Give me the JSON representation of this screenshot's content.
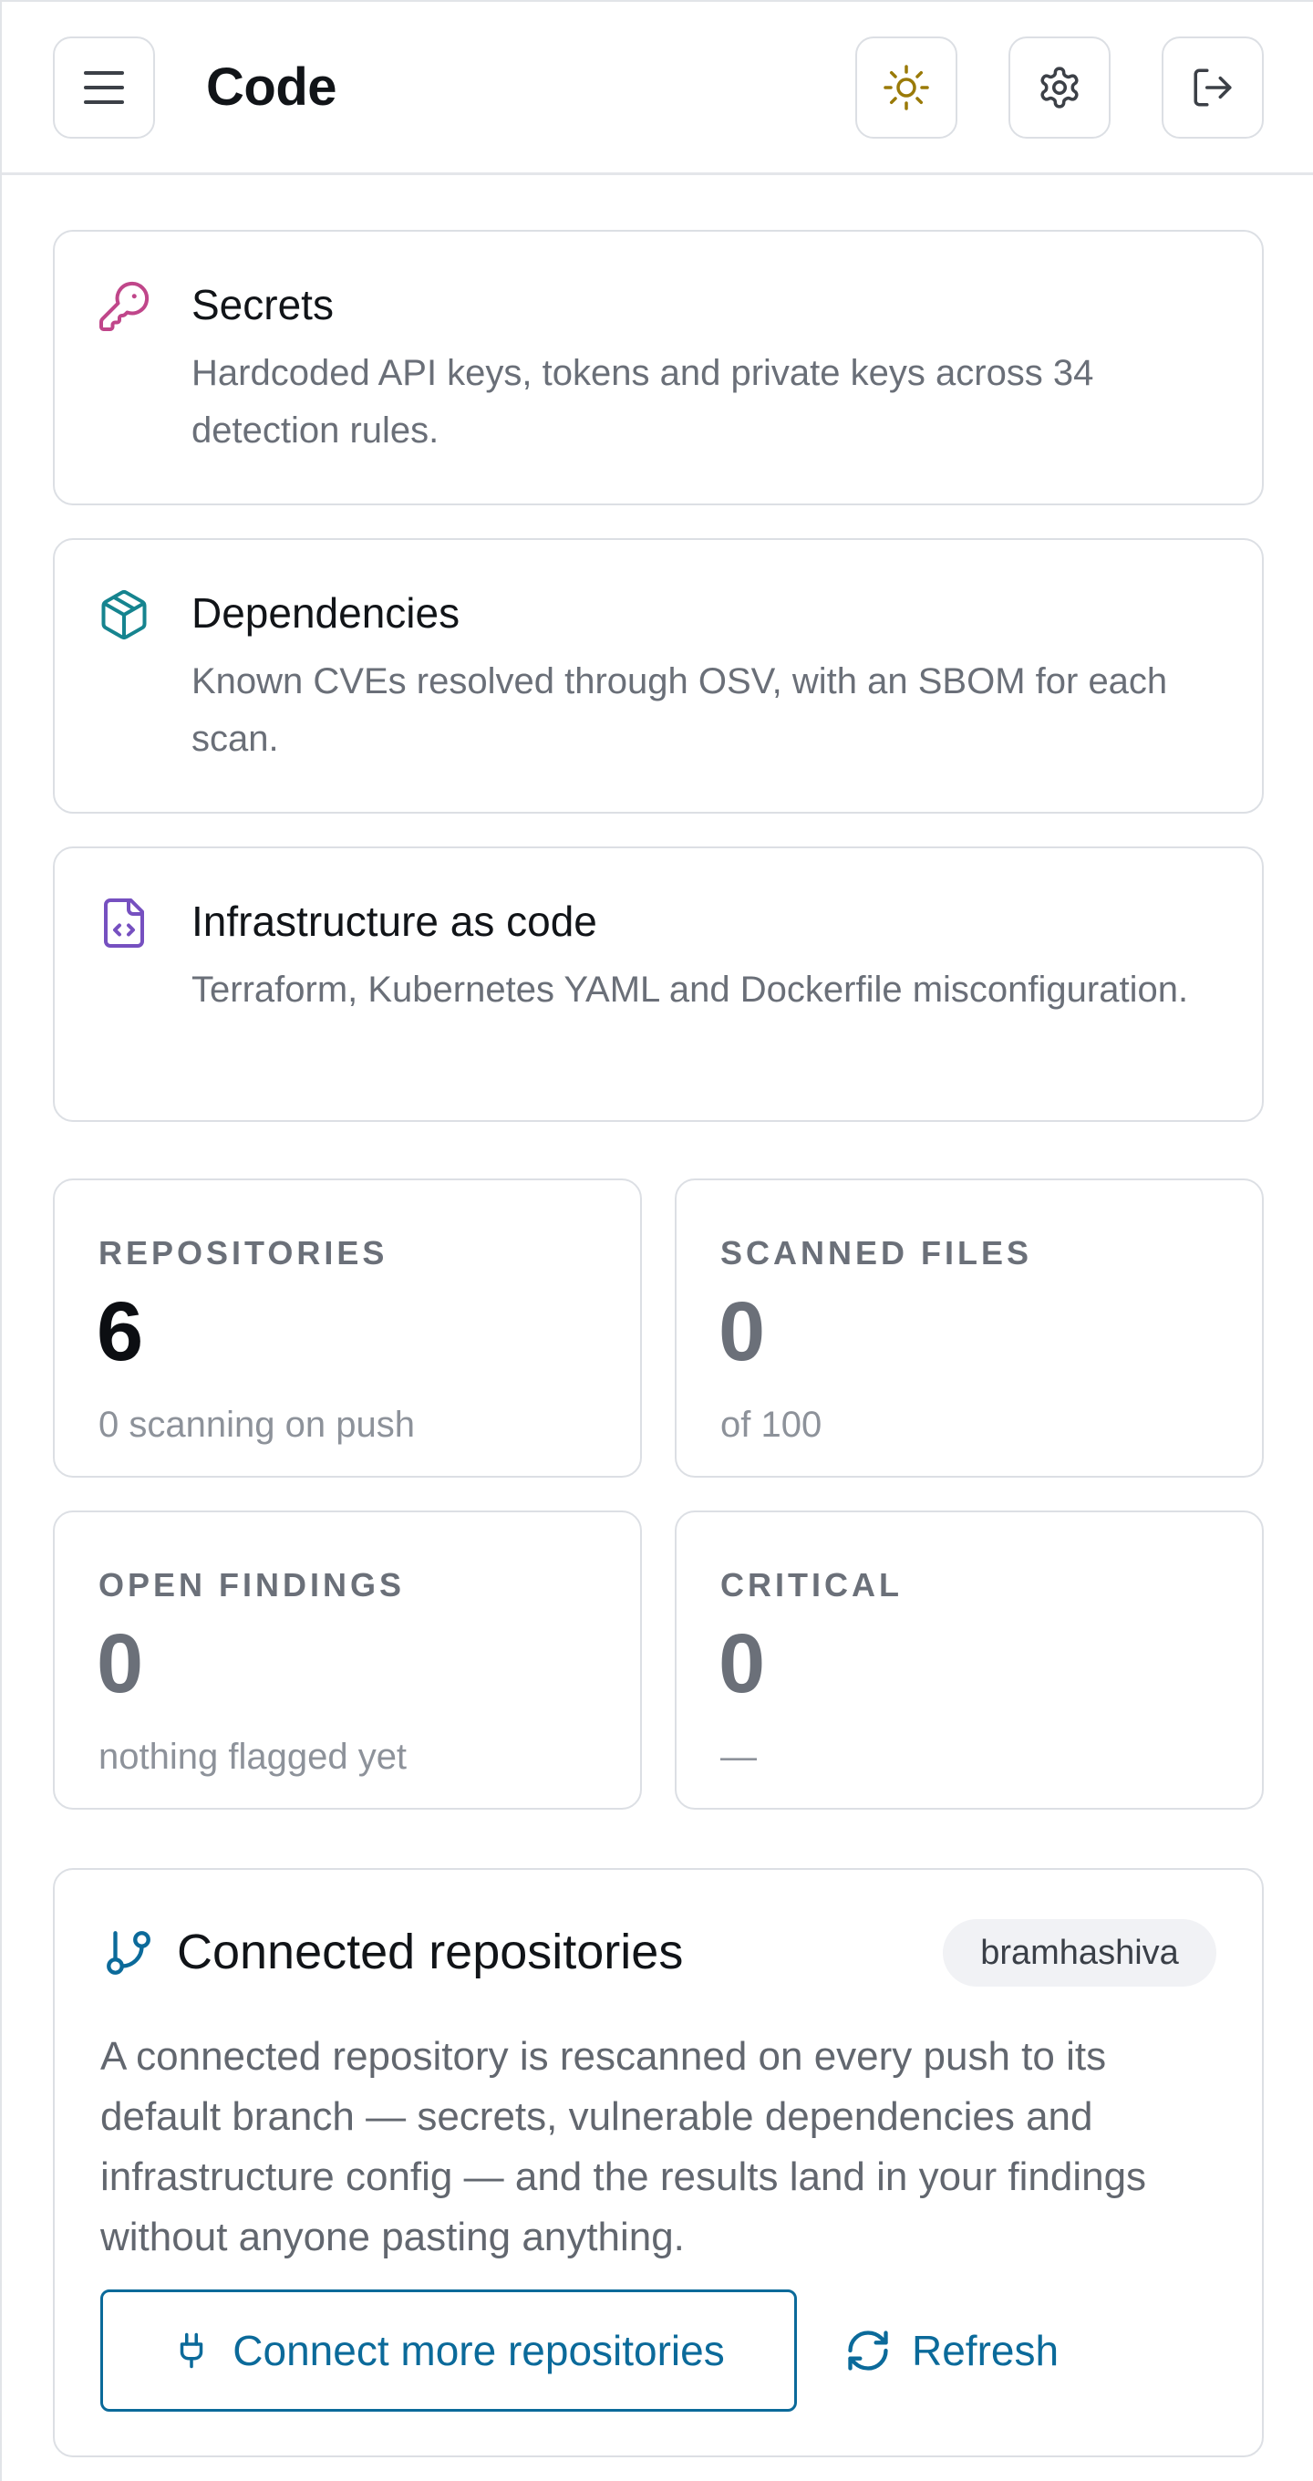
{
  "header": {
    "title": "Code",
    "menu_icon": "hamburger-menu-icon",
    "theme_icon": "sun-icon",
    "settings_icon": "gear-icon",
    "logout_icon": "logout-icon"
  },
  "features": [
    {
      "icon": "key-icon",
      "icon_color": "#c0468a",
      "title": "Secrets",
      "description": "Hardcoded API keys, tokens and private keys across 34 detection rules."
    },
    {
      "icon": "package-icon",
      "icon_color": "#16848f",
      "title": "Dependencies",
      "description": "Known CVEs resolved through OSV, with an SBOM for each scan."
    },
    {
      "icon": "file-code-icon",
      "icon_color": "#7650c0",
      "title": "Infrastructure as code",
      "description": "Terraform, Kubernetes YAML and Dockerfile misconfiguration."
    }
  ],
  "stats": {
    "repositories": {
      "label": "REPOSITORIES",
      "value": "6",
      "sub": "0 scanning on push"
    },
    "scanned_files": {
      "label": "SCANNED FILES",
      "value": "0",
      "sub": "of 100"
    },
    "open_findings": {
      "label": "OPEN FINDINGS",
      "value": "0",
      "sub": "nothing flagged yet"
    },
    "critical": {
      "label": "CRITICAL",
      "value": "0",
      "sub": "—"
    }
  },
  "connected": {
    "icon": "git-branch-icon",
    "title": "Connected repositories",
    "badge": "bramhashiva",
    "description": "A connected repository is rescanned on every push to its default branch — secrets, vulnerable dependencies and infrastructure config — and the results land in your findings without anyone pasting anything.",
    "connect_label": "Connect more repositories",
    "refresh_label": "Refresh",
    "accent": "#0b6a9a"
  }
}
